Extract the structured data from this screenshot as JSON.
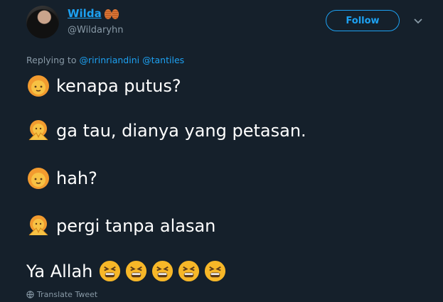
{
  "header": {
    "display_name": "Wilda",
    "handle": "@Wildaryhn",
    "follow_label": "Follow"
  },
  "reply": {
    "prefix": "Replying to",
    "mentions": [
      "@ririnriandini",
      "@tantiles"
    ]
  },
  "messages": [
    {
      "emoji": "girl-emoji",
      "text": "kenapa putus?"
    },
    {
      "emoji": "no-hands-emoji",
      "text": "ga tau, dianya yang petasan."
    },
    {
      "emoji": "girl-emoji",
      "text": "hah?"
    },
    {
      "emoji": "no-hands-emoji",
      "text": "pergi tanpa alasan"
    }
  ],
  "closing": {
    "text": "Ya Allah",
    "emoji": "tired-face-emoji",
    "emoji_count": 5
  },
  "footer": {
    "translate_label": "Translate Tweet"
  },
  "colors": {
    "background": "#15202b",
    "accent": "#1da1f2",
    "muted": "#8899a6",
    "emoji": "#f7b728"
  }
}
